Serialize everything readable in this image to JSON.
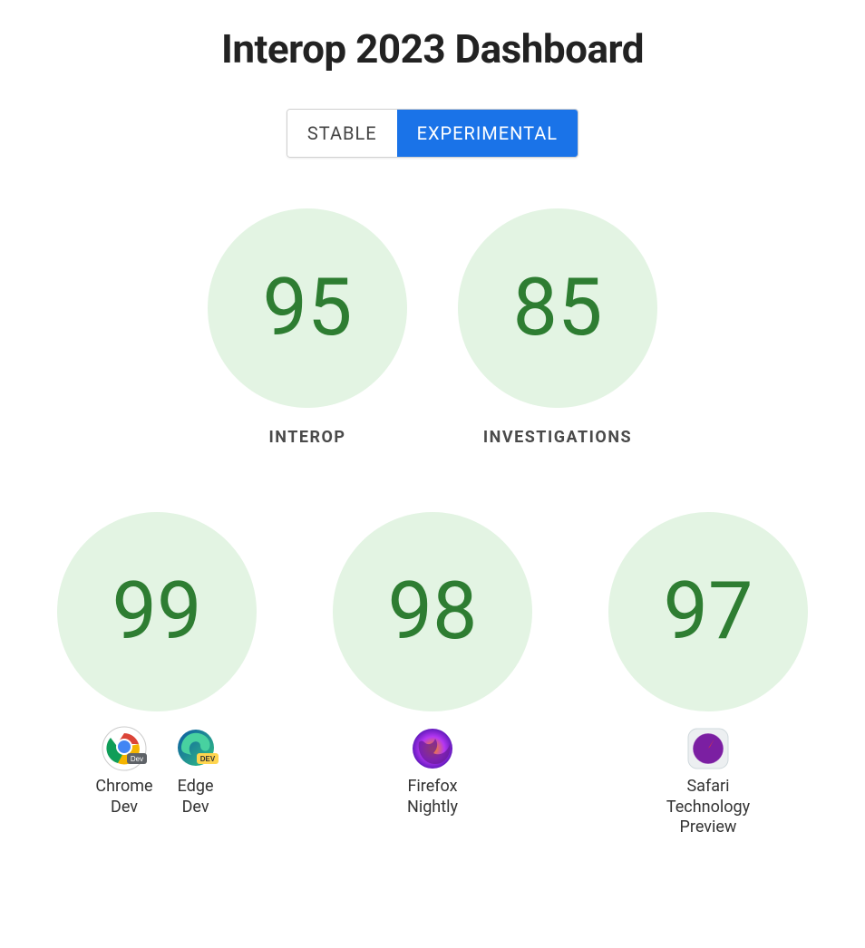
{
  "title": "Interop 2023 Dashboard",
  "toggle": {
    "stable": "STABLE",
    "experimental": "EXPERIMENTAL",
    "active": "experimental"
  },
  "top": [
    {
      "score": "95",
      "label": "INTEROP"
    },
    {
      "score": "85",
      "label": "INVESTIGATIONS"
    }
  ],
  "bottom": [
    {
      "score": "99",
      "browsers": [
        {
          "icon": "chrome-dev-icon",
          "label": "Chrome\nDev"
        },
        {
          "icon": "edge-dev-icon",
          "label": "Edge\nDev"
        }
      ]
    },
    {
      "score": "98",
      "browsers": [
        {
          "icon": "firefox-nightly-icon",
          "label": "Firefox\nNightly"
        }
      ]
    },
    {
      "score": "97",
      "browsers": [
        {
          "icon": "safari-tp-icon",
          "label": "Safari\nTechnology\nPreview"
        }
      ]
    }
  ]
}
